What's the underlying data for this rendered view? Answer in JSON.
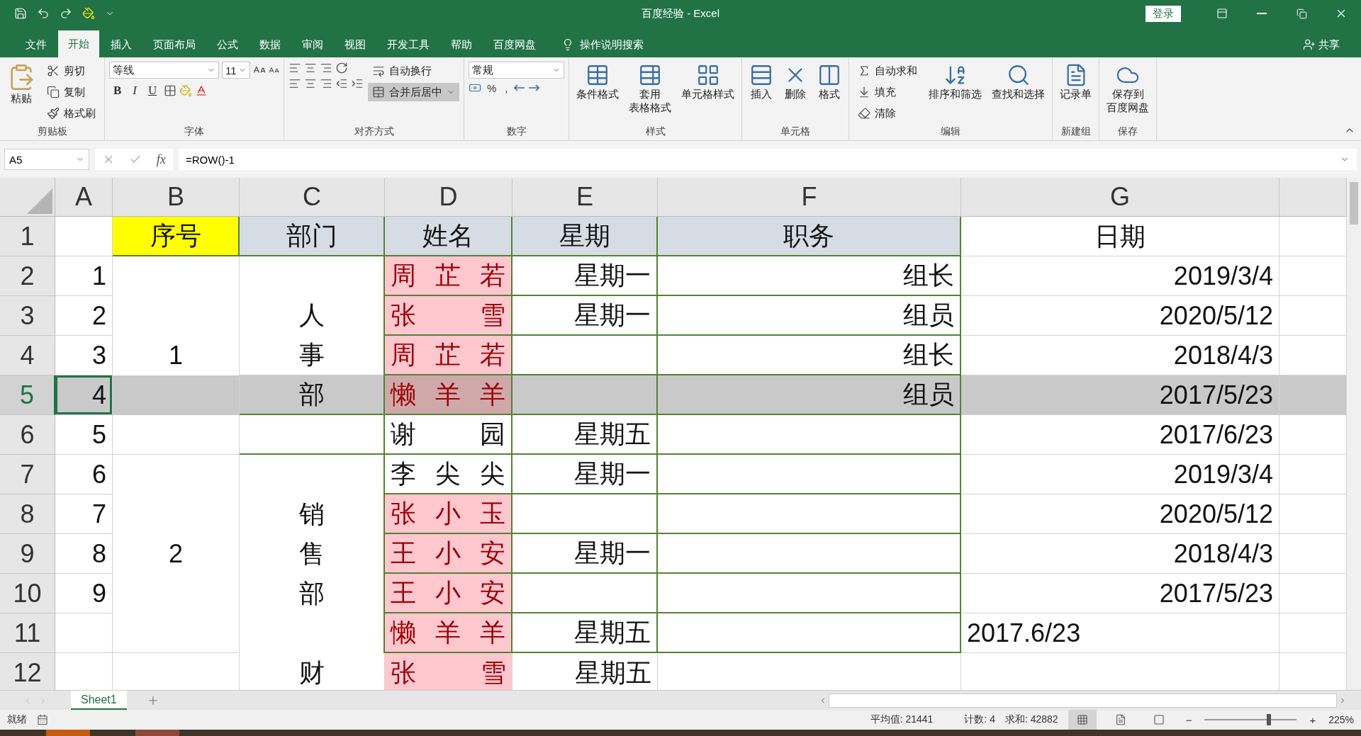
{
  "window": {
    "title": "百度经验 - Excel",
    "sign_in": "登录"
  },
  "menu": {
    "tabs": [
      {
        "label": "文件",
        "selected": false
      },
      {
        "label": "开始",
        "selected": true
      },
      {
        "label": "插入",
        "selected": false
      },
      {
        "label": "页面布局",
        "selected": false
      },
      {
        "label": "公式",
        "selected": false
      },
      {
        "label": "数据",
        "selected": false
      },
      {
        "label": "审阅",
        "selected": false
      },
      {
        "label": "视图",
        "selected": false
      },
      {
        "label": "开发工具",
        "selected": false
      },
      {
        "label": "帮助",
        "selected": false
      },
      {
        "label": "百度网盘",
        "selected": false
      }
    ],
    "tell_me": "操作说明搜索",
    "share": "共享"
  },
  "ribbon": {
    "clipboard": {
      "title": "剪贴板",
      "paste": "粘贴",
      "items": [
        "剪切",
        "复制",
        "格式刷"
      ]
    },
    "font": {
      "title": "字体",
      "name": "等线",
      "size": "11",
      "styles": [
        "B",
        "I",
        "U"
      ]
    },
    "alignment": {
      "title": "对齐方式",
      "wrap": "自动换行",
      "merge": {
        "label": "合并后居中",
        "on": true
      }
    },
    "number": {
      "title": "数字",
      "format": "常规",
      "symbols": [
        "%",
        ","
      ]
    },
    "styles": {
      "title": "样式",
      "items": [
        [
          "条件格式"
        ],
        [
          "套用",
          "表格格式"
        ],
        [
          "单元格样式"
        ]
      ]
    },
    "cells": {
      "title": "单元格",
      "items": [
        "插入",
        "删除",
        "格式"
      ]
    },
    "editing": {
      "title": "编辑",
      "items": [
        "自动求和",
        "填充",
        "清除"
      ],
      "big": [
        "排序和筛选",
        "查找和选择"
      ]
    },
    "record": {
      "title": "新建组",
      "items": [
        [
          "记录单"
        ]
      ]
    },
    "save": {
      "title": "保存",
      "items": [
        [
          "保存到",
          "百度网盘"
        ]
      ]
    }
  },
  "formula_bar": {
    "name_box": "A5",
    "fx": "fx",
    "formula": "=ROW()-1"
  },
  "sheet": {
    "columns": [
      "A",
      "B",
      "C",
      "D",
      "E",
      "F",
      "G"
    ],
    "rows": [
      {
        "header": "1",
        "selected": false,
        "highlighted": false,
        "cells": [
          {
            "kind": "empty"
          },
          {
            "kind": "value",
            "text": "序号",
            "color": "#ffff00"
          },
          {
            "kind": "value",
            "text": "部门",
            "color": "#d6dce4"
          },
          {
            "kind": "value",
            "text": "姓名",
            "color": "#d6dce4"
          },
          {
            "kind": "value",
            "text": "星期",
            "color": "#d6dce4"
          },
          {
            "kind": "value",
            "text": "职务",
            "color": "#d6dce4"
          },
          {
            "kind": "value",
            "text": "日期"
          }
        ]
      },
      {
        "header": "2",
        "selected": false,
        "highlighted": false,
        "cells": [
          {
            "kind": "value",
            "text": "1"
          },
          {
            "kind": "empty"
          },
          {
            "kind": "empty"
          },
          {
            "kind": "value",
            "text": "周芷若",
            "flagged": true
          },
          {
            "kind": "value",
            "text": "星期一"
          },
          {
            "kind": "value",
            "text": "组长"
          },
          {
            "kind": "value",
            "text": "2019/3/4"
          }
        ]
      },
      {
        "header": "3",
        "selected": false,
        "highlighted": false,
        "cells": [
          {
            "kind": "value",
            "text": "2"
          },
          {
            "kind": "empty"
          },
          {
            "kind": "value",
            "text": "人事部"
          },
          {
            "kind": "value",
            "text": "张雪",
            "flagged": true
          },
          {
            "kind": "value",
            "text": "星期一"
          },
          {
            "kind": "value",
            "text": "组员"
          },
          {
            "kind": "value",
            "text": "2020/5/12"
          }
        ]
      },
      {
        "header": "4",
        "selected": false,
        "highlighted": false,
        "cells": [
          {
            "kind": "value",
            "text": "3"
          },
          {
            "kind": "value",
            "text": "1"
          },
          {
            "kind": "covered"
          },
          {
            "kind": "value",
            "text": "周芷若",
            "flagged": true
          },
          {
            "kind": "empty"
          },
          {
            "kind": "value",
            "text": "组长"
          },
          {
            "kind": "value",
            "text": "2018/4/3"
          }
        ]
      },
      {
        "header": "5",
        "selected": true,
        "highlighted": true,
        "cells": [
          {
            "kind": "value",
            "text": "4"
          },
          {
            "kind": "empty"
          },
          {
            "kind": "covered"
          },
          {
            "kind": "value",
            "text": "懒羊羊",
            "flagged": true
          },
          {
            "kind": "empty"
          },
          {
            "kind": "value",
            "text": "组员"
          },
          {
            "kind": "value",
            "text": "2017/5/23"
          }
        ]
      },
      {
        "header": "6",
        "selected": false,
        "highlighted": false,
        "cells": [
          {
            "kind": "value",
            "text": "5"
          },
          {
            "kind": "empty"
          },
          {
            "kind": "empty"
          },
          {
            "kind": "value",
            "text": "谢园"
          },
          {
            "kind": "value",
            "text": "星期五"
          },
          {
            "kind": "empty"
          },
          {
            "kind": "value",
            "text": "2017/6/23"
          }
        ]
      },
      {
        "header": "7",
        "selected": false,
        "highlighted": false,
        "cells": [
          {
            "kind": "value",
            "text": "6"
          },
          {
            "kind": "empty"
          },
          {
            "kind": "empty"
          },
          {
            "kind": "value",
            "text": "李尖尖"
          },
          {
            "kind": "value",
            "text": "星期一"
          },
          {
            "kind": "empty"
          },
          {
            "kind": "value",
            "text": "2019/3/4"
          }
        ]
      },
      {
        "header": "8",
        "selected": false,
        "highlighted": false,
        "cells": [
          {
            "kind": "value",
            "text": "7"
          },
          {
            "kind": "empty"
          },
          {
            "kind": "value",
            "text": "销售部"
          },
          {
            "kind": "value",
            "text": "张小玉",
            "flagged": true
          },
          {
            "kind": "empty"
          },
          {
            "kind": "empty"
          },
          {
            "kind": "value",
            "text": "2020/5/12"
          }
        ]
      },
      {
        "header": "9",
        "selected": false,
        "highlighted": false,
        "cells": [
          {
            "kind": "value",
            "text": "8"
          },
          {
            "kind": "value",
            "text": "2"
          },
          {
            "kind": "covered"
          },
          {
            "kind": "value",
            "text": "王小安",
            "flagged": true
          },
          {
            "kind": "value",
            "text": "星期一"
          },
          {
            "kind": "empty"
          },
          {
            "kind": "value",
            "text": "2018/4/3"
          }
        ]
      },
      {
        "header": "10",
        "selected": false,
        "highlighted": false,
        "cells": [
          {
            "kind": "value",
            "text": "9"
          },
          {
            "kind": "empty"
          },
          {
            "kind": "covered"
          },
          {
            "kind": "value",
            "text": "王小安",
            "flagged": true
          },
          {
            "kind": "empty"
          },
          {
            "kind": "empty"
          },
          {
            "kind": "value",
            "text": "2017/5/23"
          }
        ]
      },
      {
        "header": "11",
        "selected": false,
        "highlighted": false,
        "cells": [
          {
            "kind": "empty"
          },
          {
            "kind": "empty"
          },
          {
            "kind": "empty"
          },
          {
            "kind": "value",
            "text": "懒羊羊",
            "flagged": true
          },
          {
            "kind": "value",
            "text": "星期五"
          },
          {
            "kind": "empty"
          },
          {
            "kind": "value_left",
            "text": "2017.6/23"
          }
        ]
      },
      {
        "header": "12",
        "selected": false,
        "highlighted": false,
        "cells": [
          {
            "kind": "empty"
          },
          {
            "kind": "empty"
          },
          {
            "kind": "value",
            "text": "财"
          },
          {
            "kind": "value",
            "text": "张雪",
            "flagged": true
          },
          {
            "kind": "value",
            "text": "星期五"
          },
          {
            "kind": "empty"
          },
          {
            "kind": "empty"
          }
        ]
      }
    ]
  },
  "sheet_tabs": [
    {
      "label": "Sheet1",
      "selected": true
    }
  ],
  "status_bar": {
    "ready": "就绪",
    "average": "平均值: 21441",
    "count": "计数: 4",
    "sum": "求和: 42882",
    "zoom_minus": "−",
    "zoom_plus": "+",
    "zoom": {
      "level": 0.7
    },
    "zoom_text": "225%"
  }
}
